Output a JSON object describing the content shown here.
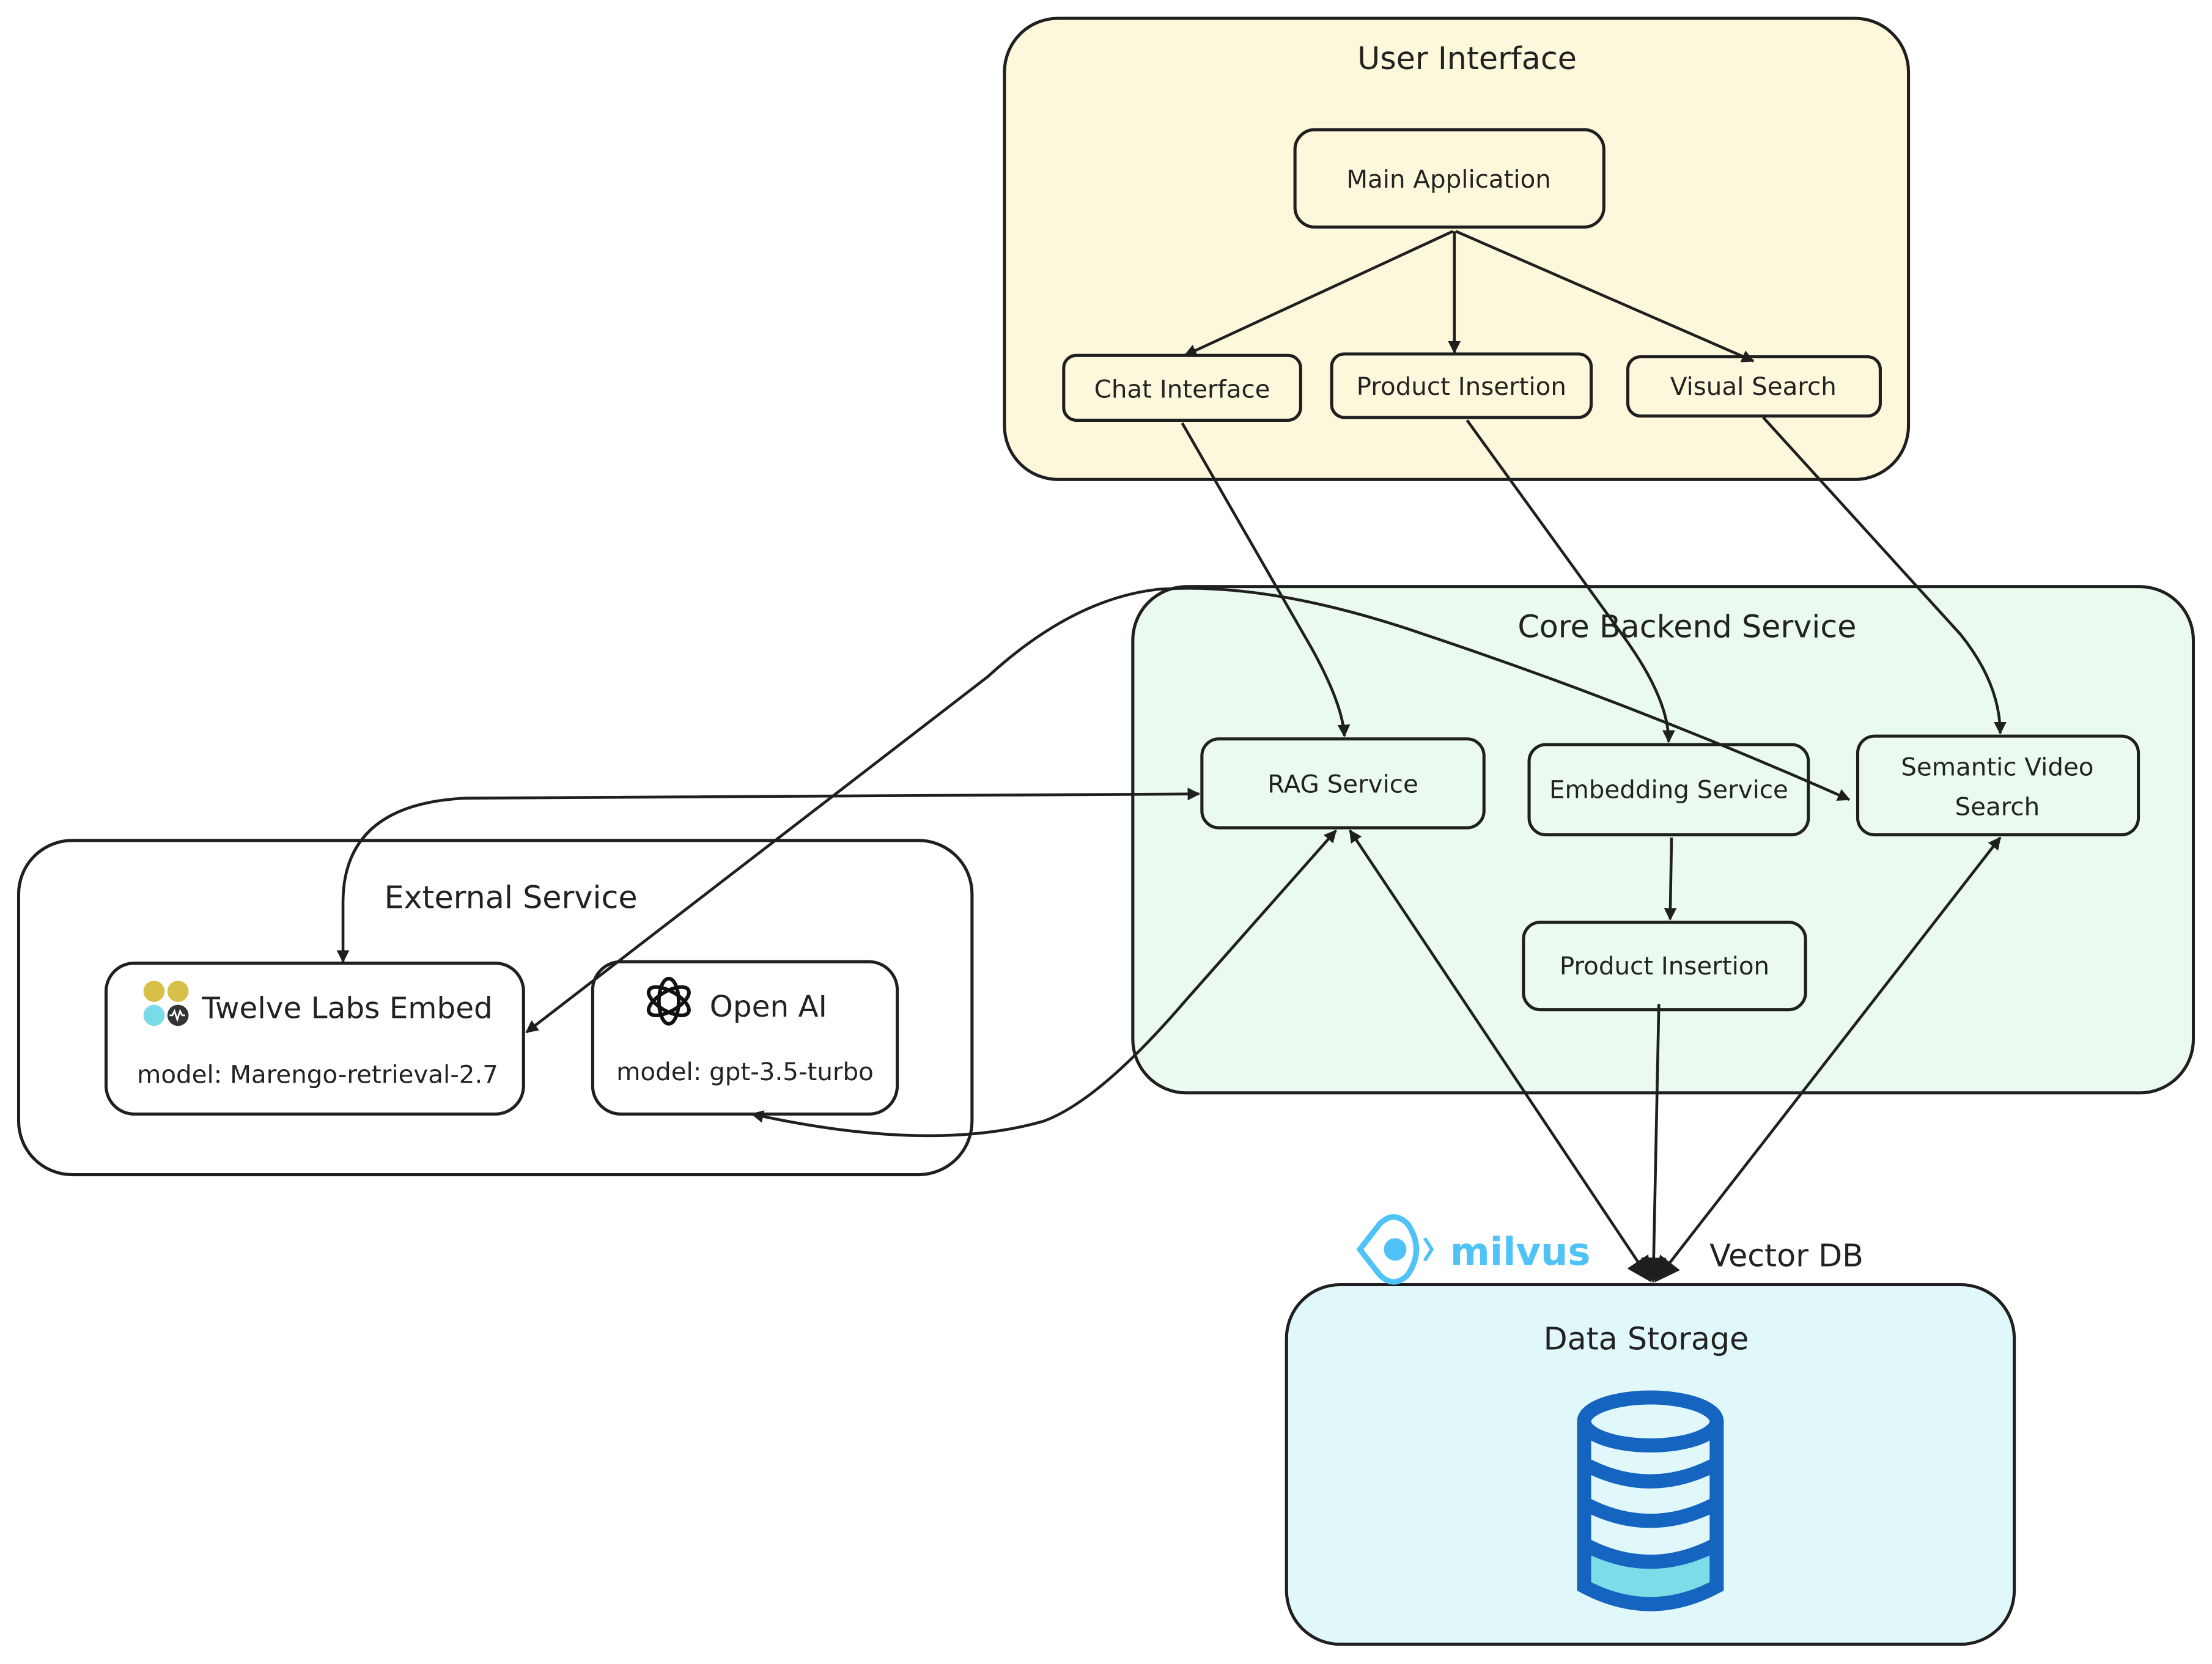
{
  "groups": {
    "ui": {
      "title": "User Interface",
      "color": "#fdf8dc"
    },
    "core": {
      "title": "Core Backend Service",
      "color": "#eafaee"
    },
    "external": {
      "title": "External Service",
      "color": "#ffffff"
    },
    "storage": {
      "title": "Data Storage",
      "color": "#e0f8fa"
    }
  },
  "nodes": {
    "main_app": "Main Application",
    "chat": "Chat Interface",
    "product_ui": "Product Insertion",
    "visual_search": "Visual Search",
    "rag": "RAG Service",
    "embedding": "Embedding Service",
    "semantic_line1": "Semantic Video",
    "semantic_line2": "Search",
    "product_core": "Product Insertion",
    "twelve_labs": {
      "title": "Twelve Labs Embed",
      "model": "model: Marengo-retrieval-2.7",
      "icon": "twelve-labs-logo"
    },
    "openai": {
      "title": "Open AI",
      "model": "model: gpt-3.5-turbo",
      "icon": "openai-logo"
    }
  },
  "vector_db": {
    "logo_text": "milvus",
    "label": "Vector DB",
    "logo_color": "#4fc3f7",
    "db_icon": "database-icon",
    "db_color": "#1565c0"
  }
}
